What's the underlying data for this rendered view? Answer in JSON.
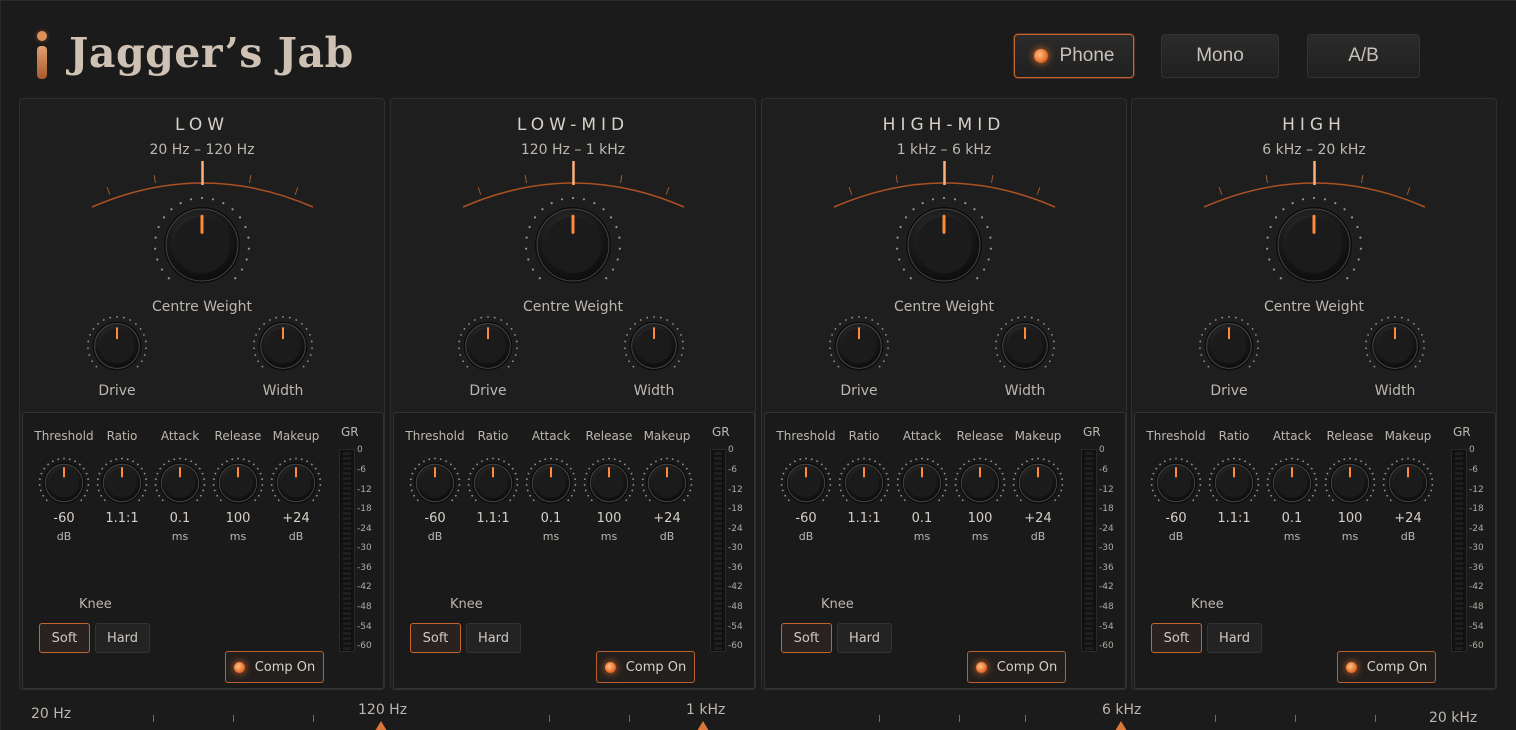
{
  "app": {
    "title": "Jagger’s Jab"
  },
  "header": {
    "buttons": [
      {
        "label": "Phone",
        "active": true
      },
      {
        "label": "Mono",
        "active": false
      },
      {
        "label": "A/B",
        "active": false
      }
    ]
  },
  "bands": [
    {
      "name": "LOW",
      "range": "20 Hz – 120 Hz",
      "centre_weight_label": "Centre Weight",
      "drive_label": "Drive",
      "width_label": "Width",
      "params": [
        {
          "label": "Threshold",
          "value": "-60",
          "unit": "dB"
        },
        {
          "label": "Ratio",
          "value": "1.1:1",
          "unit": ""
        },
        {
          "label": "Attack",
          "value": "0.1",
          "unit": "ms"
        },
        {
          "label": "Release",
          "value": "100",
          "unit": "ms"
        },
        {
          "label": "Makeup",
          "value": "+24",
          "unit": "dB"
        }
      ],
      "gr_label": "GR",
      "knee_label": "Knee",
      "knee_soft": "Soft",
      "knee_hard": "Hard",
      "knee_selected": "Soft",
      "comp_label": "Comp On"
    },
    {
      "name": "LOW-MID",
      "range": "120 Hz – 1 kHz",
      "centre_weight_label": "Centre Weight",
      "drive_label": "Drive",
      "width_label": "Width",
      "params": [
        {
          "label": "Threshold",
          "value": "-60",
          "unit": "dB"
        },
        {
          "label": "Ratio",
          "value": "1.1:1",
          "unit": ""
        },
        {
          "label": "Attack",
          "value": "0.1",
          "unit": "ms"
        },
        {
          "label": "Release",
          "value": "100",
          "unit": "ms"
        },
        {
          "label": "Makeup",
          "value": "+24",
          "unit": "dB"
        }
      ],
      "gr_label": "GR",
      "knee_label": "Knee",
      "knee_soft": "Soft",
      "knee_hard": "Hard",
      "knee_selected": "Soft",
      "comp_label": "Comp On"
    },
    {
      "name": "HIGH-MID",
      "range": "1 kHz – 6 kHz",
      "centre_weight_label": "Centre Weight",
      "drive_label": "Drive",
      "width_label": "Width",
      "params": [
        {
          "label": "Threshold",
          "value": "-60",
          "unit": "dB"
        },
        {
          "label": "Ratio",
          "value": "1.1:1",
          "unit": ""
        },
        {
          "label": "Attack",
          "value": "0.1",
          "unit": "ms"
        },
        {
          "label": "Release",
          "value": "100",
          "unit": "ms"
        },
        {
          "label": "Makeup",
          "value": "+24",
          "unit": "dB"
        }
      ],
      "gr_label": "GR",
      "knee_label": "Knee",
      "knee_soft": "Soft",
      "knee_hard": "Hard",
      "knee_selected": "Soft",
      "comp_label": "Comp On"
    },
    {
      "name": "HIGH",
      "range": "6 kHz – 20 kHz",
      "centre_weight_label": "Centre Weight",
      "drive_label": "Drive",
      "width_label": "Width",
      "params": [
        {
          "label": "Threshold",
          "value": "-60",
          "unit": "dB"
        },
        {
          "label": "Ratio",
          "value": "1.1:1",
          "unit": ""
        },
        {
          "label": "Attack",
          "value": "0.1",
          "unit": "ms"
        },
        {
          "label": "Release",
          "value": "100",
          "unit": "ms"
        },
        {
          "label": "Makeup",
          "value": "+24",
          "unit": "dB"
        }
      ],
      "gr_label": "GR",
      "knee_label": "Knee",
      "knee_soft": "Soft",
      "knee_hard": "Hard",
      "knee_selected": "Soft",
      "comp_label": "Comp On"
    }
  ],
  "gr_scale": [
    "0",
    "-6",
    "-12",
    "-18",
    "-24",
    "-30",
    "-36",
    "-42",
    "-48",
    "-54",
    "-60"
  ],
  "freq_axis": {
    "labels": [
      "20 Hz",
      "120 Hz",
      "1 kHz",
      "6 kHz",
      "20 kHz"
    ],
    "crossovers": [
      "120 Hz",
      "1 kHz",
      "6 kHz"
    ]
  },
  "colors": {
    "accent": "#e8702a",
    "background": "#1b1b1b",
    "panel": "#1e1e1e",
    "text": "#c9c4bd"
  }
}
